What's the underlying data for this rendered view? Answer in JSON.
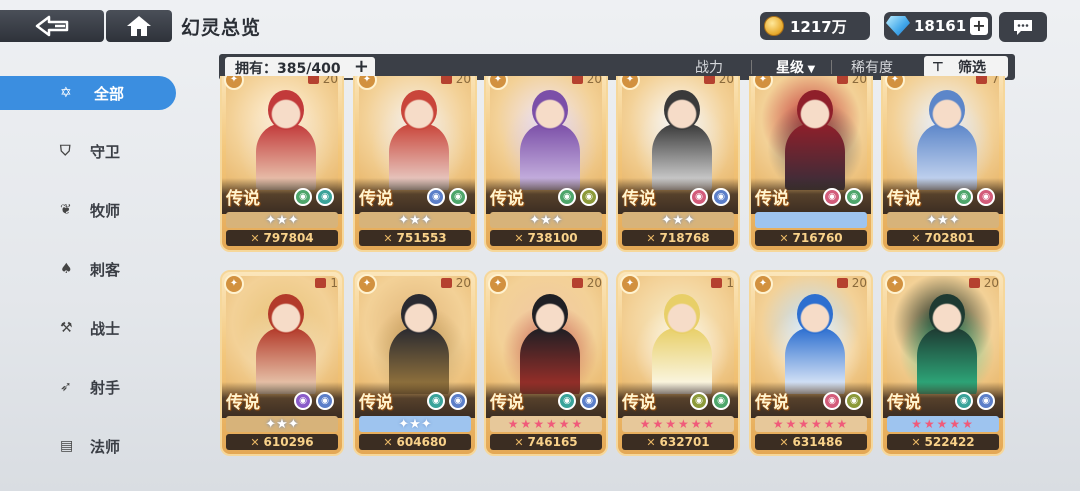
{
  "header": {
    "title": "幻灵总览",
    "gold": "1217万",
    "gems": "18161"
  },
  "filterbar": {
    "owned_label": "拥有：385/400",
    "sort_power": "战力",
    "sort_star": "星级",
    "sort_rarity": "稀有度",
    "filter_label": "筛选"
  },
  "sidebar": {
    "items": [
      {
        "label": "全部",
        "icon": "all-star-icon",
        "active": true
      },
      {
        "label": "守卫",
        "icon": "shield-icon"
      },
      {
        "label": "牧师",
        "icon": "wings-icon"
      },
      {
        "label": "刺客",
        "icon": "assassin-icon"
      },
      {
        "label": "战士",
        "icon": "axe-icon"
      },
      {
        "label": "射手",
        "icon": "bow-icon"
      },
      {
        "label": "法师",
        "icon": "book-icon"
      }
    ]
  },
  "cards": [
    {
      "rarity": "传说",
      "count": "20",
      "power": "797804",
      "elements": [
        "#4ea66b",
        "#3aa39a"
      ],
      "starbar": "crest",
      "palette": [
        "#c23a3a",
        "#f1e0c6",
        "#fff3e0"
      ]
    },
    {
      "rarity": "传说",
      "count": "20",
      "power": "751553",
      "elements": [
        "#5c7fc9",
        "#4ea66b"
      ],
      "starbar": "crest",
      "palette": [
        "#c9453a",
        "#eee6df",
        "#f7f1ea"
      ]
    },
    {
      "rarity": "传说",
      "count": "20",
      "power": "738100",
      "elements": [
        "#4ea66b",
        "#8c9a3a"
      ],
      "starbar": "crest",
      "palette": [
        "#7b4fa8",
        "#d6c6ea",
        "#efe6f8"
      ]
    },
    {
      "rarity": "传说",
      "count": "20",
      "power": "718768",
      "elements": [
        "#d35c7a",
        "#5c7fc9"
      ],
      "starbar": "crest",
      "palette": [
        "#3a3a3a",
        "#eeeeee",
        "#fafafa"
      ]
    },
    {
      "rarity": "传说",
      "count": "20",
      "power": "716760",
      "elements": [
        "#d35c7a",
        "#4ea66b"
      ],
      "starbar": "blue-empty",
      "palette": [
        "#8f1f2a",
        "#2f2f3b",
        "#c43a3a"
      ]
    },
    {
      "rarity": "传说",
      "count": "7",
      "power": "702801",
      "elements": [
        "#4ea66b",
        "#d35c7a"
      ],
      "starbar": "crest",
      "palette": [
        "#5c86c9",
        "#d9e4f7",
        "#eef3fb"
      ]
    },
    {
      "rarity": "传说",
      "count": "1",
      "power": "610296",
      "elements": [
        "#8a5cc9",
        "#5c7fc9"
      ],
      "starbar": "crest",
      "palette": [
        "#b33a2a",
        "#f3e4c8",
        "#e8c37a"
      ]
    },
    {
      "rarity": "传说",
      "count": "20",
      "power": "604680",
      "elements": [
        "#3aa39a",
        "#5c7fc9"
      ],
      "starbar": "blue-crest",
      "palette": [
        "#2a2a30",
        "#a8823f",
        "#e1b67a"
      ]
    },
    {
      "rarity": "传说",
      "count": "20",
      "power": "746165",
      "elements": [
        "#3aa39a",
        "#5c7fc9"
      ],
      "starbar": "pink6",
      "palette": [
        "#1f1f24",
        "#b3322a",
        "#f1c8a3"
      ]
    },
    {
      "rarity": "传说",
      "count": "1",
      "power": "632701",
      "elements": [
        "#8c9a3a",
        "#4ea66b"
      ],
      "starbar": "pink6",
      "palette": [
        "#e8cf68",
        "#ffffff",
        "#f7ecc8"
      ]
    },
    {
      "rarity": "传说",
      "count": "20",
      "power": "631486",
      "elements": [
        "#d35c7a",
        "#8c9a3a"
      ],
      "starbar": "pink6",
      "palette": [
        "#2d6fd0",
        "#ffffff",
        "#bfe0ff"
      ]
    },
    {
      "rarity": "传说",
      "count": "20",
      "power": "522422",
      "elements": [
        "#3aa39a",
        "#5c7fc9"
      ],
      "starbar": "pink5",
      "palette": [
        "#1e3a32",
        "#31c28a",
        "#0d2019"
      ]
    }
  ]
}
